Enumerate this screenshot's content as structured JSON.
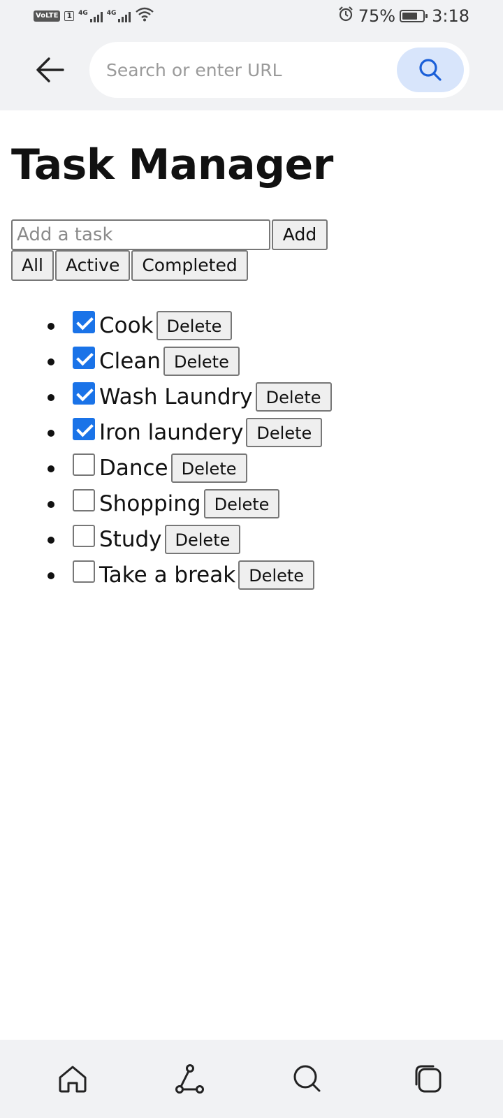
{
  "status_bar": {
    "volte": "VoLTE",
    "sim": "1",
    "network_1": "4G",
    "network_2": "4G",
    "battery_percent": "75%",
    "battery_level": 0.75,
    "time": "3:18"
  },
  "browser": {
    "url_placeholder": "Search or enter URL",
    "url_value": ""
  },
  "page": {
    "title": "Task Manager",
    "add_placeholder": "Add a task",
    "add_label": "Add",
    "filters": [
      "All",
      "Active",
      "Completed"
    ],
    "delete_label": "Delete",
    "tasks": [
      {
        "label": "Cook",
        "checked": true
      },
      {
        "label": "Clean",
        "checked": true
      },
      {
        "label": "Wash Laundry",
        "checked": true
      },
      {
        "label": "Iron laundery",
        "checked": true
      },
      {
        "label": "Dance",
        "checked": false
      },
      {
        "label": "Shopping",
        "checked": false
      },
      {
        "label": "Study",
        "checked": false
      },
      {
        "label": "Take a break",
        "checked": false
      }
    ]
  },
  "colors": {
    "checkbox_accent": "#1a73e8",
    "search_button_bg": "#d8e5fb",
    "chrome_bg": "#f1f2f4"
  },
  "icons": {
    "back": "arrow-left-icon",
    "search": "search-icon",
    "alarm": "alarm-icon",
    "wifi": "wifi-icon",
    "home": "home-icon",
    "share": "share-nodes-icon",
    "nav_search": "search-icon",
    "tabs": "tabs-icon"
  }
}
